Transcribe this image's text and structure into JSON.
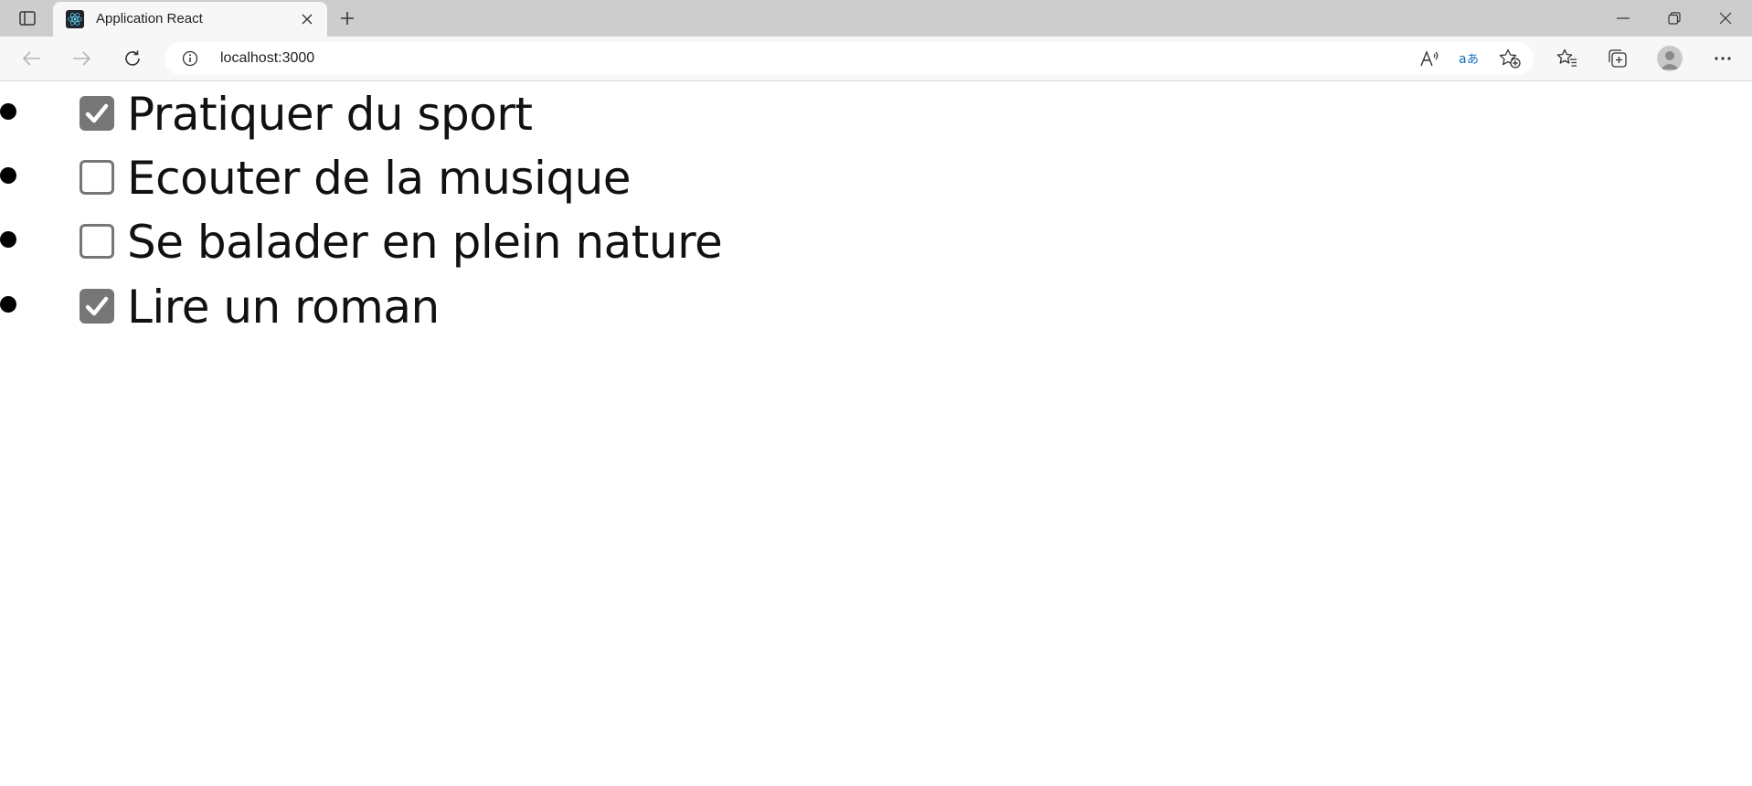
{
  "browser": {
    "tab": {
      "title": "Application React",
      "favicon": "react-logo-icon"
    },
    "address_bar": {
      "url": "localhost:3000"
    },
    "icons": {
      "tab_actions": "tab-actions-icon",
      "close_tab": "close-icon",
      "new_tab": "plus-icon",
      "minimize": "minimize-icon",
      "restore": "restore-icon",
      "close_window": "close-icon",
      "back": "arrow-left-icon",
      "forward": "arrow-right-icon",
      "refresh": "refresh-icon",
      "site_info": "info-icon",
      "read_aloud": "read-aloud-icon",
      "translate": "translate-icon",
      "add_favorite": "star-add-icon",
      "favorites": "favorites-icon",
      "collections": "collections-icon",
      "profile": "avatar",
      "more": "more-icon"
    }
  },
  "page": {
    "hobbies": [
      {
        "label": "Pratiquer du sport",
        "checked": true
      },
      {
        "label": "Ecouter de la musique",
        "checked": false
      },
      {
        "label": "Se balader en plein nature",
        "checked": false
      },
      {
        "label": "Lire un roman",
        "checked": true
      }
    ]
  },
  "colors": {
    "tabstrip": "#cdcdcd",
    "toolbar": "#f7f7f7",
    "checkbox": "#767676",
    "translate_accent": "#0f6cbd"
  }
}
